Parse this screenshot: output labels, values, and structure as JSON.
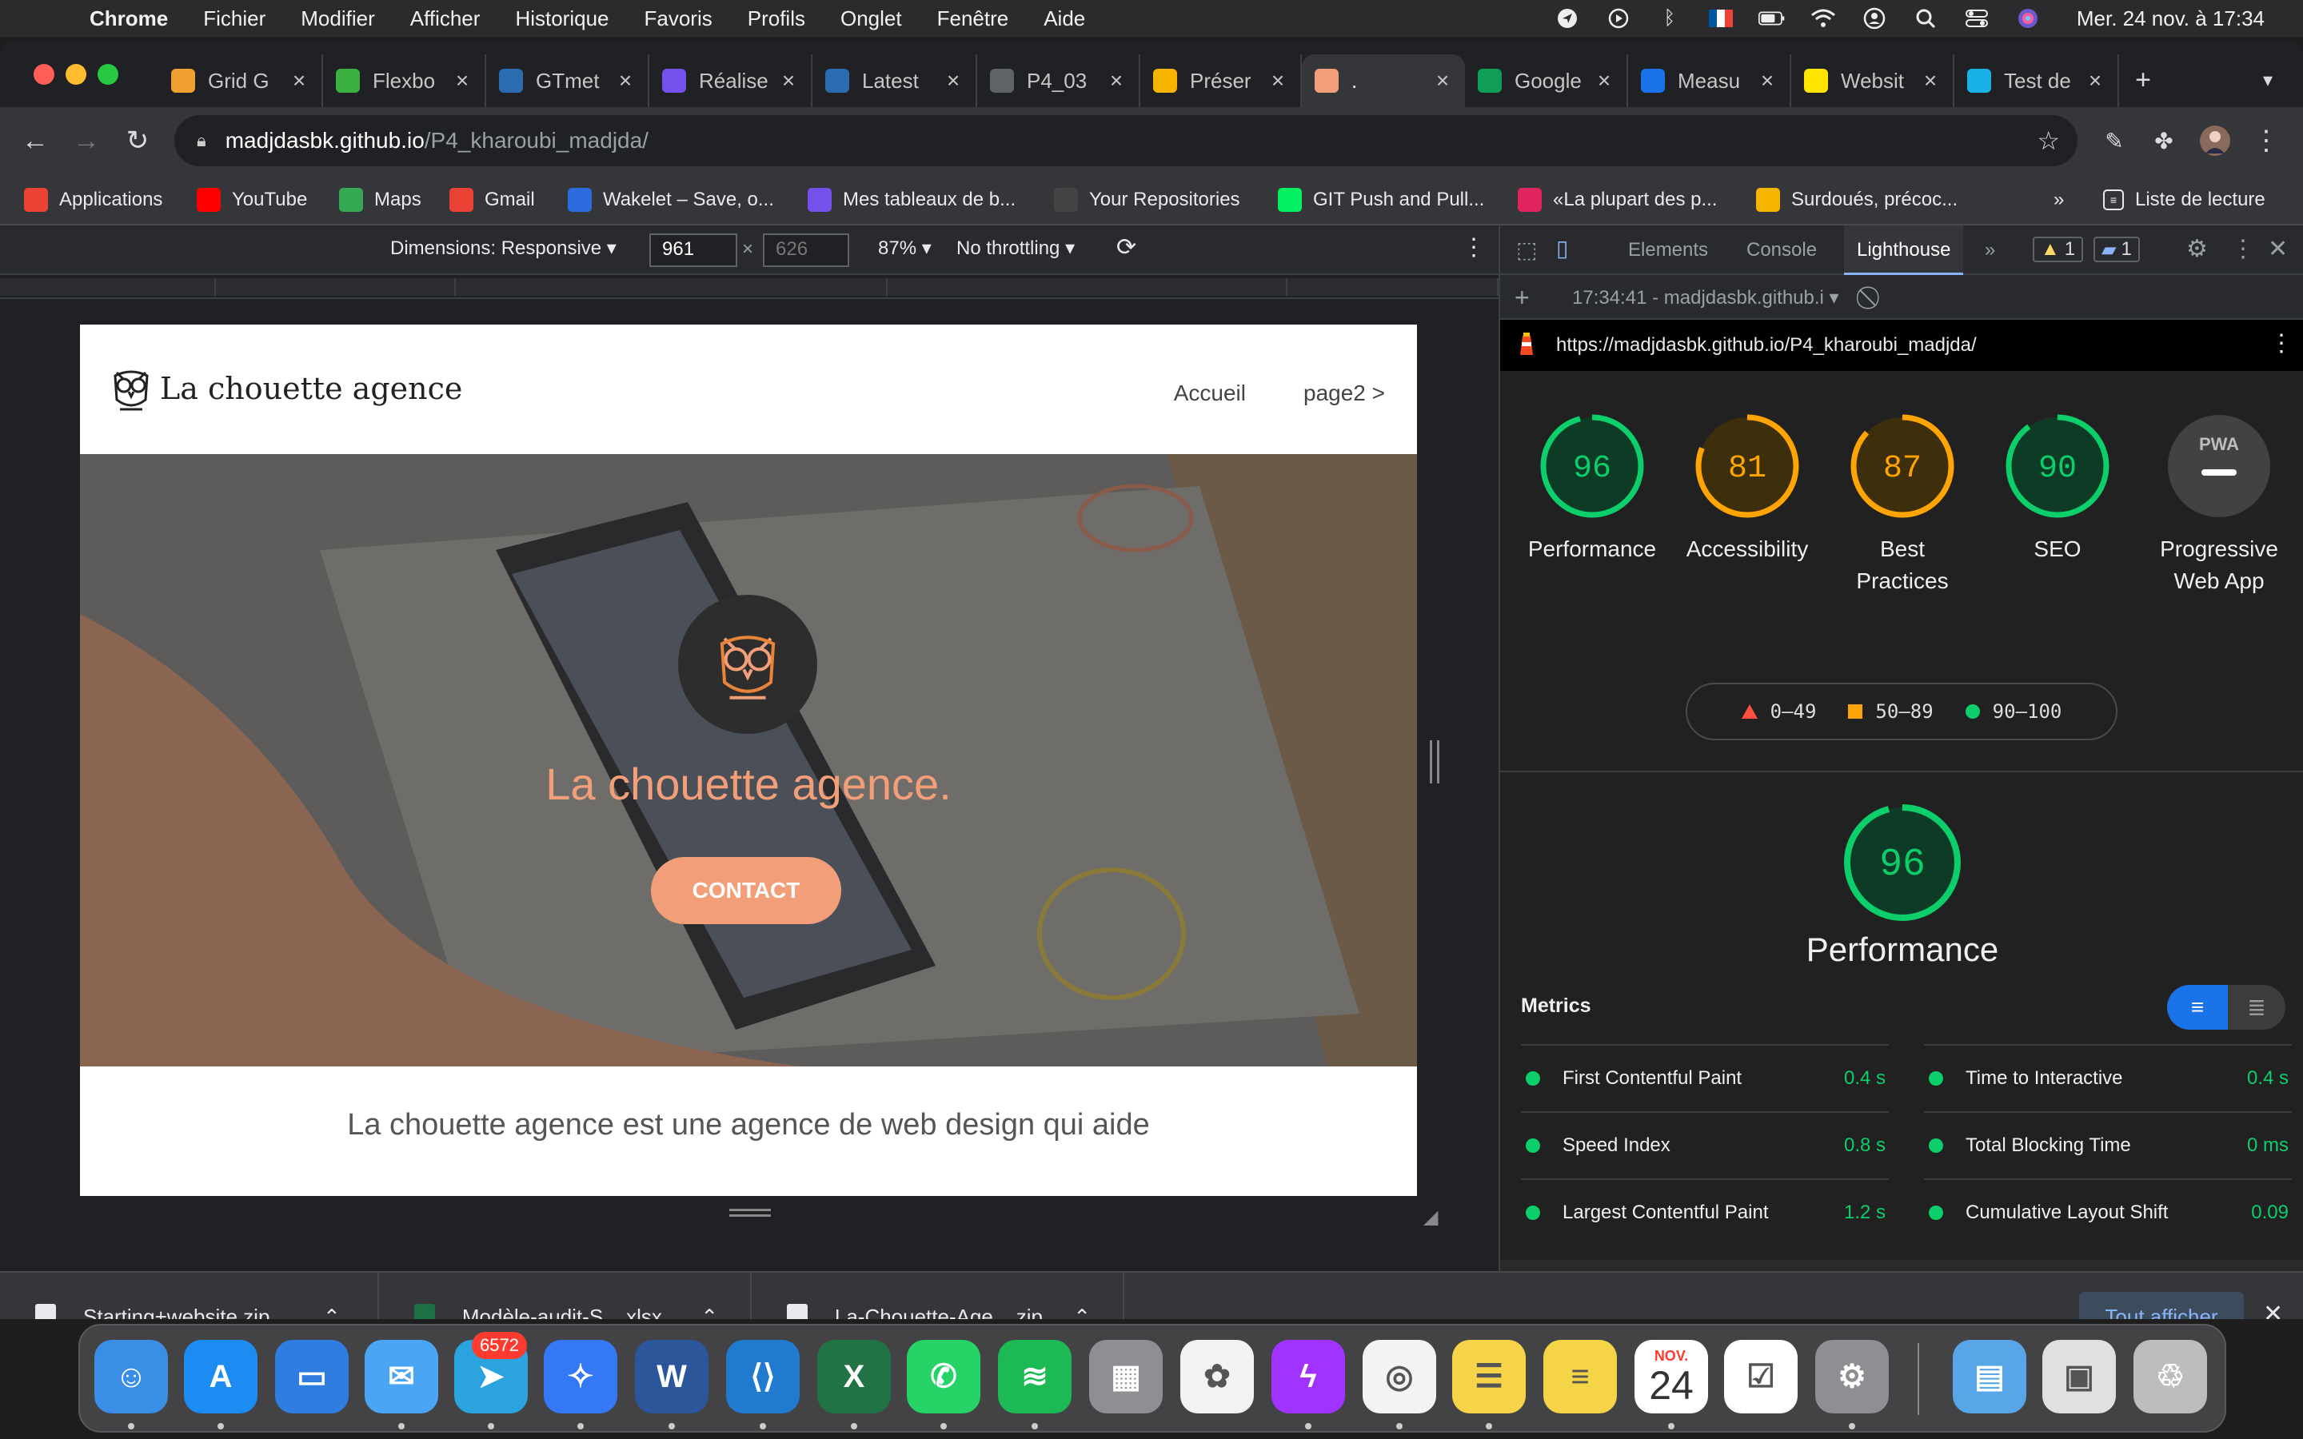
{
  "menubar": {
    "app_name": "Chrome",
    "items": [
      "Fichier",
      "Modifier",
      "Afficher",
      "Historique",
      "Favoris",
      "Profils",
      "Onglet",
      "Fenêtre",
      "Aide"
    ],
    "clock": "Mer. 24 nov. à  17:34"
  },
  "tabs": [
    {
      "label": "Grid G",
      "icon": "plant-icon",
      "color": "#f0a030"
    },
    {
      "label": "Flexbo",
      "icon": "frog-icon",
      "color": "#3cb043"
    },
    {
      "label": "GTmet",
      "icon": "gtmetrix-icon",
      "color": "#2b6cb0"
    },
    {
      "label": "Réalise",
      "icon": "openclassrooms-icon",
      "color": "#7451eb"
    },
    {
      "label": "Latest",
      "icon": "gtmetrix-icon",
      "color": "#2b6cb0"
    },
    {
      "label": "P4_03",
      "icon": "globe-icon",
      "color": "#5f6368"
    },
    {
      "label": "Préser",
      "icon": "slides-icon",
      "color": "#f4b400"
    },
    {
      "label": ".",
      "icon": "owl-icon",
      "color": "#f29f79"
    },
    {
      "label": "Google",
      "icon": "sheets-icon",
      "color": "#0f9d58"
    },
    {
      "label": "Measu",
      "icon": "measure-icon",
      "color": "#1a73e8"
    },
    {
      "label": "Websit",
      "icon": "p-icon",
      "color": "#ffe500"
    },
    {
      "label": "Test de",
      "icon": "uptrends-icon",
      "color": "#1ab0e8"
    }
  ],
  "address": {
    "host": "madjdasbk.github.io",
    "path": "/P4_kharoubi_madjda/"
  },
  "bookmarks": [
    {
      "label": "Applications",
      "icon": "apps-grid-icon",
      "color": "#ea4335"
    },
    {
      "label": "YouTube",
      "icon": "youtube-icon",
      "color": "#ff0000"
    },
    {
      "label": "Maps",
      "icon": "maps-icon",
      "color": "#34a853"
    },
    {
      "label": "Gmail",
      "icon": "gmail-icon",
      "color": "#ea4335"
    },
    {
      "label": "Wakelet – Save, o...",
      "icon": "wakelet-icon",
      "color": "#2d6cdf"
    },
    {
      "label": "Mes tableaux de b...",
      "icon": "openclassrooms-icon",
      "color": "#7451eb"
    },
    {
      "label": "Your Repositories",
      "icon": "github-icon",
      "color": "#444444"
    },
    {
      "label": "GIT Push and Pull...",
      "icon": "dc-icon",
      "color": "#03ef62"
    },
    {
      "label": "«La plupart des p...",
      "icon": "bookmark-red-icon",
      "color": "#e0245e"
    },
    {
      "label": "Surdoués, précoc...",
      "icon": "colorful-icon",
      "color": "#f4b400"
    }
  ],
  "bookmarks_more": "»",
  "reading_list": "Liste de lecture",
  "device": {
    "dimensions_label": "Dimensions: Responsive ▾",
    "width": "961",
    "height": "626",
    "zoom": "87% ▾",
    "throttling": "No throttling ▾"
  },
  "site": {
    "brand": "La chouette agence",
    "nav": [
      "Accueil",
      "page2 >"
    ],
    "hero_title": "La chouette agence.",
    "hero_button": "CONTACT",
    "intro": "La chouette agence est une agence de web design qui aide"
  },
  "devtools": {
    "tabs": [
      "Elements",
      "Console",
      "Lighthouse"
    ],
    "active_tab": "Lighthouse",
    "more": "»",
    "warnings": "1",
    "messages": "1",
    "report_time": "17:34:41 - madjdasbk.github.i ▾",
    "report_url": "https://madjdasbk.github.io/P4_kharoubi_madjda/",
    "gauges": [
      {
        "score": 96,
        "label_lines": [
          "Performance"
        ],
        "color": "#0cce6b",
        "bg": "#0e3b25"
      },
      {
        "score": 81,
        "label_lines": [
          "Accessibility"
        ],
        "color": "#ffa400",
        "bg": "#3d2e0c"
      },
      {
        "score": 87,
        "label_lines": [
          "Best",
          "Practices"
        ],
        "color": "#ffa400",
        "bg": "#3d2e0c"
      },
      {
        "score": 90,
        "label_lines": [
          "SEO"
        ],
        "color": "#0cce6b",
        "bg": "#0e3b25"
      }
    ],
    "pwa": {
      "badge": "PWA",
      "label_lines": [
        "Progressive",
        "Web App"
      ]
    },
    "legend": [
      {
        "range": "0–49",
        "shape": "triangle",
        "color": "#ff4e42"
      },
      {
        "range": "50–89",
        "shape": "square",
        "color": "#ffa400"
      },
      {
        "range": "90–100",
        "shape": "circle",
        "color": "#0cce6b"
      }
    ],
    "main_score": 96,
    "main_label": "Performance",
    "metrics_title": "Metrics",
    "metrics": [
      {
        "name": "First Contentful Paint",
        "value": "0.4 s"
      },
      {
        "name": "Time to Interactive",
        "value": "0.4 s"
      },
      {
        "name": "Speed Index",
        "value": "0.8 s"
      },
      {
        "name": "Total Blocking Time",
        "value": "0 ms"
      },
      {
        "name": "Largest Contentful Paint",
        "value": "1.2 s"
      },
      {
        "name": "Cumulative Layout Shift",
        "value": "0.09"
      }
    ]
  },
  "downloads": {
    "items": [
      "Starting+website.zip",
      "Modèle-audit-S....xlsx",
      "La-Chouette-Age....zip"
    ],
    "show_all": "Tout afficher"
  },
  "dock": {
    "mail_badge": "6572",
    "calendar_month": "NOV.",
    "calendar_day": "24",
    "apps": [
      {
        "name": "finder-icon",
        "color": "#3a8ee6"
      },
      {
        "name": "app-store-icon",
        "color": "#1c8cf2"
      },
      {
        "name": "keynote-icon",
        "color": "#2f7de1"
      },
      {
        "name": "mail-icon",
        "color": "#4aa6f5"
      },
      {
        "name": "telegram-icon",
        "color": "#2aa3df"
      },
      {
        "name": "safari-icon",
        "color": "#3478f6"
      },
      {
        "name": "word-icon",
        "color": "#2b579a"
      },
      {
        "name": "vscode-icon",
        "color": "#1f7ad0"
      },
      {
        "name": "excel-icon",
        "color": "#217346"
      },
      {
        "name": "whatsapp-icon",
        "color": "#25d366"
      },
      {
        "name": "spotify-icon",
        "color": "#1db954"
      },
      {
        "name": "launchpad-icon",
        "color": "#8e8e93"
      },
      {
        "name": "photos-icon",
        "color": "#f2f2f2"
      },
      {
        "name": "messenger-icon",
        "color": "#a033ff"
      },
      {
        "name": "chrome-icon",
        "color": "#f1f3f4"
      },
      {
        "name": "notes-icon",
        "color": "#f7d34a"
      },
      {
        "name": "stickies-icon",
        "color": "#f5d547"
      },
      {
        "name": "calendar-icon",
        "color": "#ffffff"
      },
      {
        "name": "reminders-icon",
        "color": "#ffffff"
      },
      {
        "name": "system-preferences-icon",
        "color": "#8e8e93"
      },
      {
        "name": "downloads-folder-icon",
        "color": "#58a6e8"
      },
      {
        "name": "recent-document-icon",
        "color": "#e0e0e0"
      },
      {
        "name": "trash-icon",
        "color": "#bdbdbd"
      }
    ]
  }
}
